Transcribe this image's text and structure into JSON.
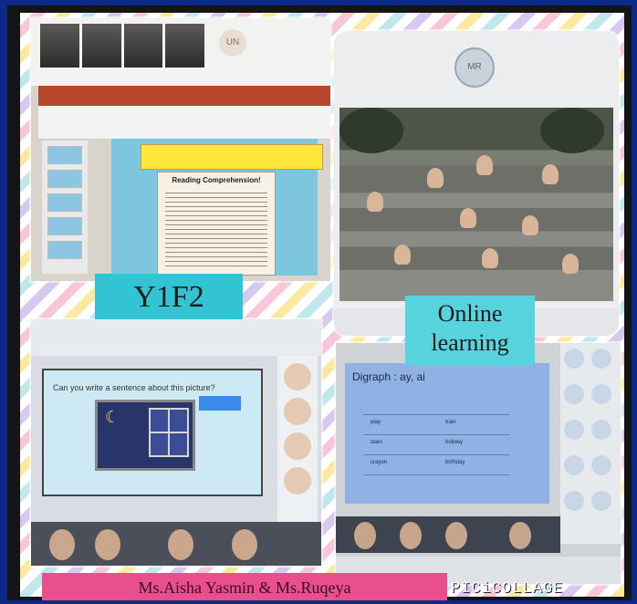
{
  "labels": {
    "class_label": "Y1F2",
    "online_label": "Online learning",
    "teachers": "Ms.Aisha Yasmin & Ms.Ruqeya",
    "brand": "PICiCOLLAGE"
  },
  "screen1": {
    "avatar_initials": "UN",
    "reading_title": "Reading Comprehension!"
  },
  "screen2": {
    "avatar_initials": "MR"
  },
  "screen3": {
    "question": "Can you write a sentence about this picture?"
  },
  "screen4": {
    "slide_title": "Digraph : ay, ai",
    "words": [
      "play",
      "train",
      "stain",
      "holiday",
      "crayon",
      "birthday"
    ]
  }
}
